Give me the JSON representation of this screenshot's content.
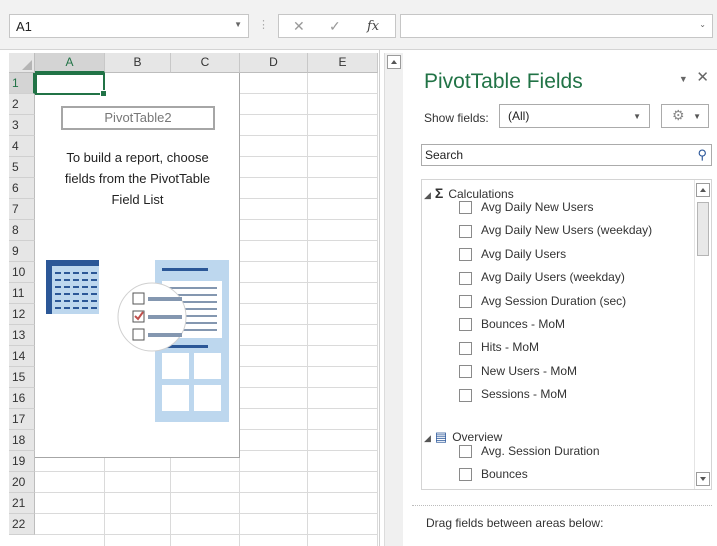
{
  "formula_bar": {
    "name_box": "A1",
    "fx_label": "fx",
    "cancel_glyph": "✕",
    "enter_glyph": "✓",
    "formula_value": ""
  },
  "sheet": {
    "columns": [
      "A",
      "B",
      "C",
      "D",
      "E"
    ],
    "rows": [
      "1",
      "2",
      "3",
      "4",
      "5",
      "6",
      "7",
      "8",
      "9",
      "10",
      "11",
      "12",
      "13",
      "14",
      "15",
      "16",
      "17",
      "18",
      "19",
      "20",
      "21",
      "22"
    ],
    "active_cell": "A1",
    "pivot_name": "PivotTable2",
    "pivot_instruction": [
      "To build a report, choose",
      "fields from the PivotTable",
      "Field List"
    ]
  },
  "panel": {
    "title": "PivotTable Fields",
    "show_fields_label": "Show fields:",
    "show_fields_value": "(All)",
    "search_placeholder": "Search",
    "groups": [
      {
        "name": "Calculations",
        "icon": "sigma-icon",
        "fields": [
          "Avg Daily New Users",
          "Avg Daily New Users (weekday)",
          "Avg Daily Users",
          "Avg Daily Users (weekday)",
          "Avg Session Duration (sec)",
          "Bounces - MoM",
          "Hits - MoM",
          "New Users - MoM",
          "Sessions - MoM"
        ]
      },
      {
        "name": "Overview",
        "icon": "table-icon",
        "fields": [
          "Avg. Session Duration",
          "Bounces"
        ]
      }
    ],
    "drag_hint": "Drag fields between areas below:"
  },
  "colors": {
    "accent": "#217346",
    "illustration_blue": "#2b5797",
    "illustration_light": "#bdd7ee",
    "check_red": "#c0504d"
  }
}
